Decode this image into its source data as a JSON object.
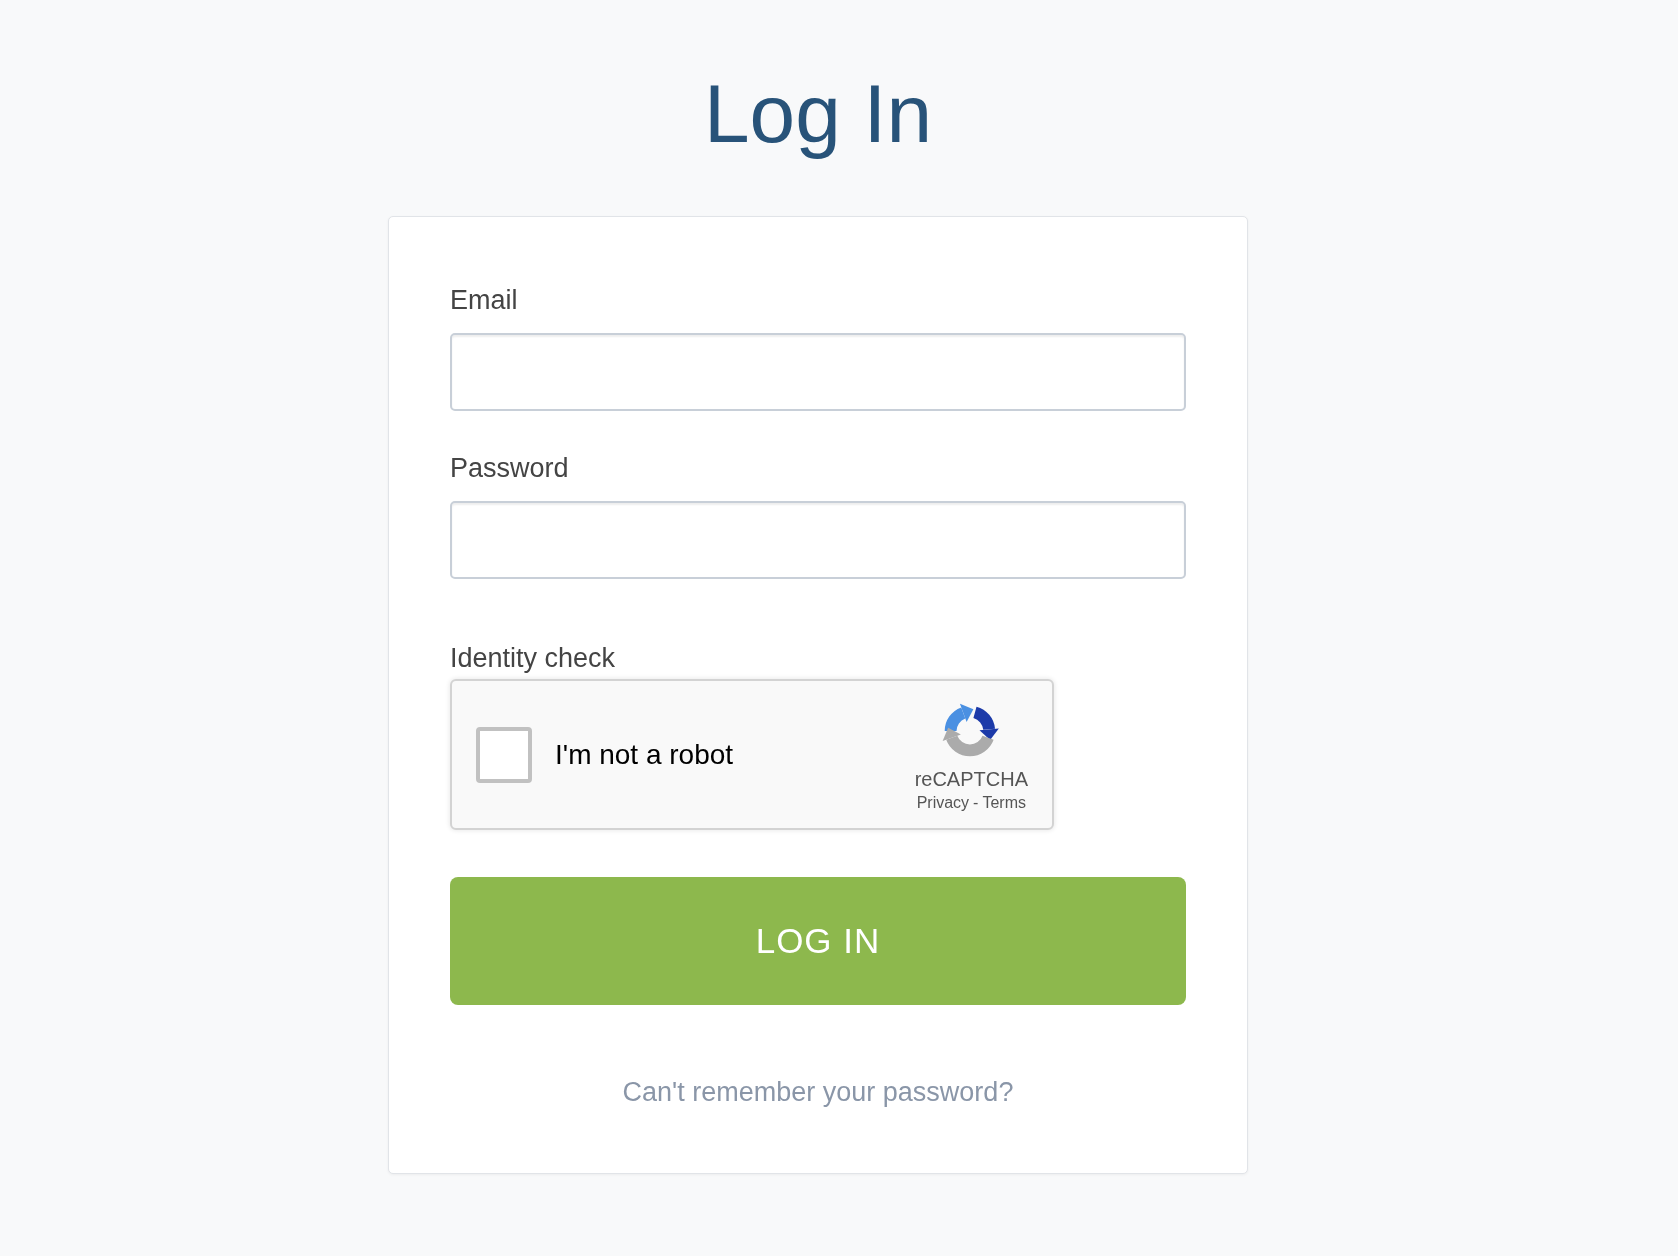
{
  "title": "Log In",
  "form": {
    "fields": [
      {
        "label": "Email"
      },
      {
        "label": "Password"
      }
    ],
    "identity_check": {
      "label": "Identity check",
      "checkbox": {
        "label": "I'm not a robot",
        "checked": false
      },
      "brand": "reCAPTCHA",
      "privacy_link": "Privacy",
      "separator": "-",
      "terms_link": "Terms"
    },
    "submit_button": "LOG IN",
    "forgot_link": "Can't remember your password?"
  }
}
